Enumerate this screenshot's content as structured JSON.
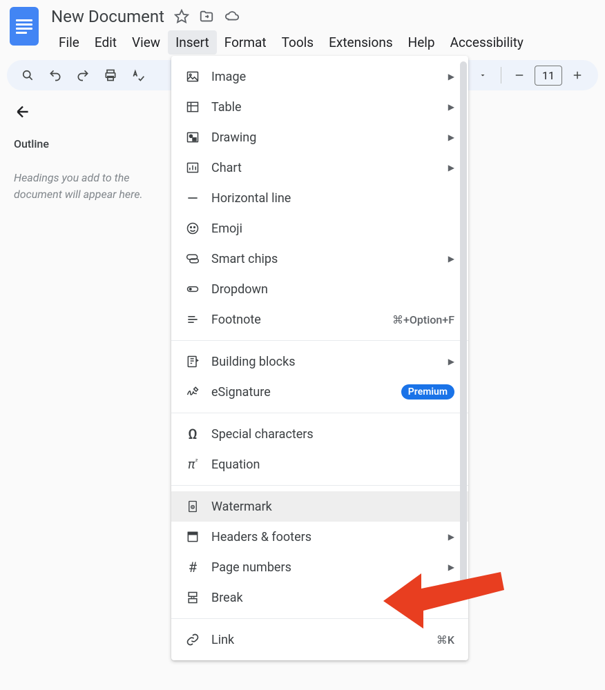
{
  "title": "New Document",
  "menubar": [
    "File",
    "Edit",
    "View",
    "Insert",
    "Format",
    "Tools",
    "Extensions",
    "Help",
    "Accessibility"
  ],
  "active_menu": "Insert",
  "toolbar": {
    "font_size": "11"
  },
  "sidebar": {
    "outline_title": "Outline",
    "outline_placeholder": "Headings you add to the document will appear here."
  },
  "dropdown": {
    "items": [
      {
        "icon": "image",
        "label": "Image",
        "submenu": true
      },
      {
        "icon": "table",
        "label": "Table",
        "submenu": true
      },
      {
        "icon": "drawing",
        "label": "Drawing",
        "submenu": true
      },
      {
        "icon": "chart",
        "label": "Chart",
        "submenu": true
      },
      {
        "icon": "hr",
        "label": "Horizontal line"
      },
      {
        "icon": "emoji",
        "label": "Emoji"
      },
      {
        "icon": "smartchips",
        "label": "Smart chips",
        "submenu": true
      },
      {
        "icon": "dropdown",
        "label": "Dropdown"
      },
      {
        "icon": "footnote",
        "label": "Footnote",
        "shortcut": "⌘+Option+F"
      },
      {
        "divider": true
      },
      {
        "icon": "building",
        "label": "Building blocks",
        "submenu": true
      },
      {
        "icon": "esignature",
        "label": "eSignature",
        "badge": "Premium"
      },
      {
        "divider": true
      },
      {
        "icon": "omega",
        "label": "Special characters"
      },
      {
        "icon": "equation",
        "label": "Equation"
      },
      {
        "divider": true
      },
      {
        "icon": "watermark",
        "label": "Watermark",
        "highlighted": true
      },
      {
        "icon": "headers",
        "label": "Headers & footers",
        "submenu": true
      },
      {
        "icon": "pagenumbers",
        "label": "Page numbers",
        "submenu": true
      },
      {
        "icon": "break",
        "label": "Break",
        "submenu": true
      },
      {
        "divider": true
      },
      {
        "icon": "link",
        "label": "Link",
        "shortcut": "⌘K"
      }
    ]
  }
}
